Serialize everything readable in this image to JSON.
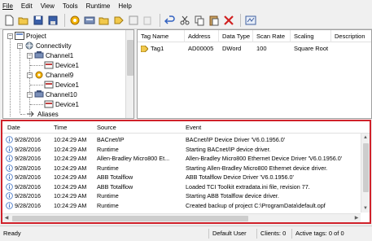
{
  "menu": [
    {
      "label": "File"
    },
    {
      "label": "Edit"
    },
    {
      "label": "View"
    },
    {
      "label": "Tools"
    },
    {
      "label": "Runtime"
    },
    {
      "label": "Help"
    }
  ],
  "toolbar_icons": [
    "new-project-icon",
    "open-icon",
    "save-icon",
    "save-as-icon",
    "new-channel-icon",
    "new-device-icon",
    "new-tag-group-icon",
    "new-tag-icon",
    "tag-properties-icon",
    "copy-disabled-icon",
    "undo-icon",
    "cut-icon",
    "copy-icon",
    "paste-icon",
    "delete-icon",
    "quick-client-icon"
  ],
  "tree": {
    "project": "Project",
    "connectivity": "Connectivity",
    "channel1": "Channel1",
    "device1a": "Device1",
    "channel9": "Channel9",
    "device1b": "Device1",
    "channel10": "Channel10",
    "device1c": "Device1",
    "aliases": "Aliases"
  },
  "tags_table": {
    "columns": [
      "Tag Name",
      "Address",
      "Data Type",
      "Scan Rate",
      "Scaling",
      "Description"
    ],
    "rows": [
      {
        "name": "Tag1",
        "address": "AD00005",
        "data_type": "DWord",
        "scan_rate": "100",
        "scaling": "Square Root",
        "description": ""
      }
    ]
  },
  "event_log": {
    "columns": [
      "Date",
      "Time",
      "Source",
      "Event"
    ],
    "rows": [
      {
        "date": "9/28/2016",
        "time": "10:24:29 AM",
        "source": "BACnet/IP",
        "event": "BACnet/IP Device Driver 'V6.0.1956.0'"
      },
      {
        "date": "9/28/2016",
        "time": "10:24:29 AM",
        "source": "Runtime",
        "event": "Starting BACnet/IP device driver."
      },
      {
        "date": "9/28/2016",
        "time": "10:24:29 AM",
        "source": "Allen-Bradley Micro800 Et...",
        "event": "Allen-Bradley Micro800 Ethernet Device Driver 'V6.0.1956.0'"
      },
      {
        "date": "9/28/2016",
        "time": "10:24:29 AM",
        "source": "Runtime",
        "event": "Starting Allen-Bradley Micro800 Ethernet device driver."
      },
      {
        "date": "9/28/2016",
        "time": "10:24:29 AM",
        "source": "ABB Totalflow",
        "event": "ABB Totalflow Device Driver 'V6.0.1956.0'"
      },
      {
        "date": "9/28/2016",
        "time": "10:24:29 AM",
        "source": "ABB Totalflow",
        "event": "Loaded TCI Toolkit extradata.ini file, revision 77."
      },
      {
        "date": "9/28/2016",
        "time": "10:24:29 AM",
        "source": "Runtime",
        "event": "Starting ABB Totalflow device driver."
      },
      {
        "date": "9/28/2016",
        "time": "10:24:29 AM",
        "source": "Runtime",
        "event": "Created backup of project  C:\\ProgramData\\default.opf"
      }
    ]
  },
  "status": {
    "ready": "Ready",
    "user": "Default User",
    "clients": "Clients: 0",
    "active_tags": "Active tags: 0 of 0"
  },
  "colors": {
    "highlight_border": "#d0212a"
  }
}
